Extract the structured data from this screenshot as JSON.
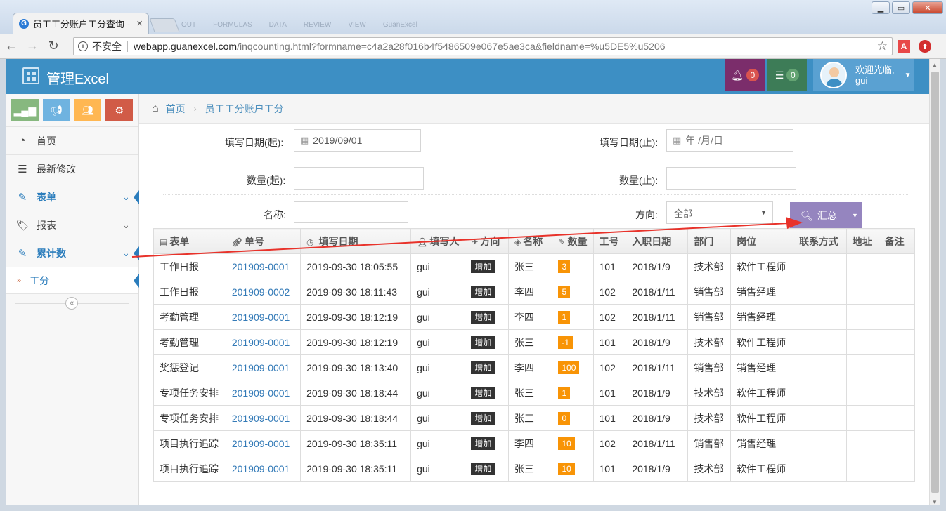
{
  "browser": {
    "tab_title": "员工工分账户工分查询 -",
    "tab_close": "×",
    "ghost_tabs": [
      "OUT",
      "FORMULAS",
      "DATA",
      "REVIEW",
      "VIEW",
      "GuanExcel"
    ],
    "security_label": "不安全",
    "url_host": "webapp.guanexcel.com",
    "url_path": "/inqcounting.html?formname=c4a2a28f016b4f5486509e067e5ae3ca&fieldname=%u5DE5%u5206",
    "window_controls": [
      "▁",
      "▭",
      "✕"
    ]
  },
  "app": {
    "brand": "管理Excel",
    "notifications_count": "0",
    "tasks_count": "0",
    "user_greeting": "欢迎光临,",
    "user_name": "gui"
  },
  "sidebar": {
    "items": [
      {
        "label": "首页",
        "icon": "dashboard-icon"
      },
      {
        "label": "最新修改",
        "icon": "list-icon"
      },
      {
        "label": "表单",
        "icon": "edit-icon"
      },
      {
        "label": "报表",
        "icon": "tag-icon"
      },
      {
        "label": "累计数",
        "icon": "edit-icon"
      }
    ],
    "sub_item": "工分"
  },
  "breadcrumb": {
    "home": "首页",
    "current": "员工工分账户工分"
  },
  "form": {
    "date_start_label": "填写日期(起):",
    "date_start_value": "2019/09/01",
    "date_end_label": "填写日期(止):",
    "date_end_placeholder": "年 /月/日",
    "qty_start_label": "数量(起):",
    "qty_end_label": "数量(止):",
    "name_label": "名称:",
    "direction_label": "方向:",
    "direction_value": "全部",
    "submit_label": "汇总"
  },
  "table": {
    "columns": [
      "表单",
      "单号",
      "填写日期",
      "填写人",
      "方向",
      "名称",
      "数量",
      "工号",
      "入职日期",
      "部门",
      "岗位",
      "联系方式",
      "地址",
      "备注"
    ],
    "rows": [
      [
        "工作日报",
        "201909-0001",
        "2019-09-30 18:05:55",
        "gui",
        "增加",
        "张三",
        "3",
        "101",
        "2018/1/9",
        "技术部",
        "软件工程师",
        "",
        "",
        ""
      ],
      [
        "工作日报",
        "201909-0002",
        "2019-09-30 18:11:43",
        "gui",
        "增加",
        "李四",
        "5",
        "102",
        "2018/1/11",
        "销售部",
        "销售经理",
        "",
        "",
        ""
      ],
      [
        "考勤管理",
        "201909-0001",
        "2019-09-30 18:12:19",
        "gui",
        "增加",
        "李四",
        "1",
        "102",
        "2018/1/11",
        "销售部",
        "销售经理",
        "",
        "",
        ""
      ],
      [
        "考勤管理",
        "201909-0001",
        "2019-09-30 18:12:19",
        "gui",
        "增加",
        "张三",
        "-1",
        "101",
        "2018/1/9",
        "技术部",
        "软件工程师",
        "",
        "",
        ""
      ],
      [
        "奖惩登记",
        "201909-0001",
        "2019-09-30 18:13:40",
        "gui",
        "增加",
        "李四",
        "100",
        "102",
        "2018/1/11",
        "销售部",
        "销售经理",
        "",
        "",
        ""
      ],
      [
        "专项任务安排",
        "201909-0001",
        "2019-09-30 18:18:44",
        "gui",
        "增加",
        "张三",
        "1",
        "101",
        "2018/1/9",
        "技术部",
        "软件工程师",
        "",
        "",
        ""
      ],
      [
        "专项任务安排",
        "201909-0001",
        "2019-09-30 18:18:44",
        "gui",
        "增加",
        "张三",
        "0",
        "101",
        "2018/1/9",
        "技术部",
        "软件工程师",
        "",
        "",
        ""
      ],
      [
        "项目执行追踪",
        "201909-0001",
        "2019-09-30 18:35:11",
        "gui",
        "增加",
        "李四",
        "10",
        "102",
        "2018/1/11",
        "销售部",
        "销售经理",
        "",
        "",
        ""
      ],
      [
        "项目执行追踪",
        "201909-0001",
        "2019-09-30 18:35:11",
        "gui",
        "增加",
        "张三",
        "10",
        "101",
        "2018/1/9",
        "技术部",
        "软件工程师",
        "",
        "",
        ""
      ]
    ]
  },
  "colors": {
    "header_blue": "#3d8fc4",
    "accent_purple": "#9585bf",
    "link_blue": "#337ab7",
    "qty_orange": "#f89406",
    "annotation_red": "#e8322a"
  }
}
